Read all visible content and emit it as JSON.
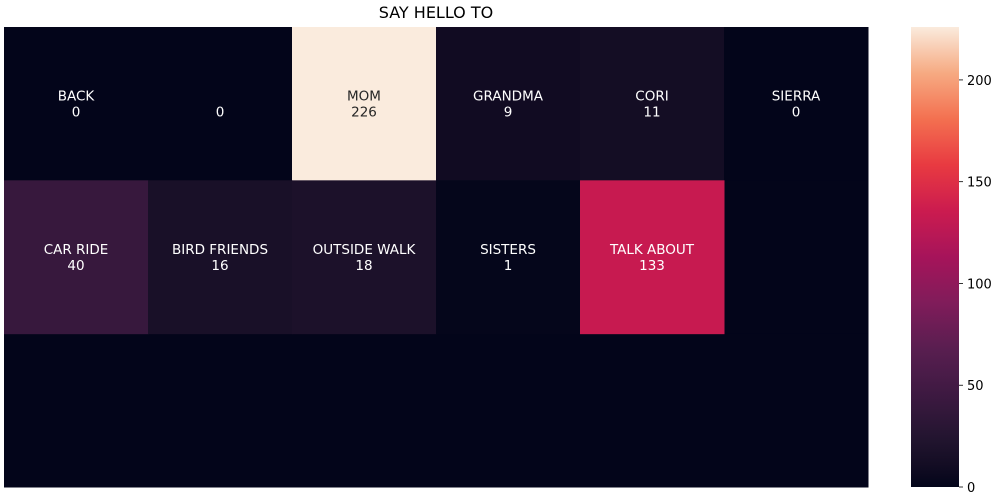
{
  "chart_data": {
    "type": "heatmap",
    "title": "SAY HELLO TO",
    "rows": 3,
    "cols": 6,
    "vmin": 0,
    "vmax": 226,
    "colormap": "rocket",
    "cells": [
      {
        "row": 0,
        "col": 0,
        "label": "BACK",
        "value": 0
      },
      {
        "row": 0,
        "col": 1,
        "label": "",
        "value": 0
      },
      {
        "row": 0,
        "col": 2,
        "label": "MOM",
        "value": 226
      },
      {
        "row": 0,
        "col": 3,
        "label": "GRANDMA",
        "value": 9
      },
      {
        "row": 0,
        "col": 4,
        "label": "CORI",
        "value": 11
      },
      {
        "row": 0,
        "col": 5,
        "label": "SIERRA",
        "value": 0
      },
      {
        "row": 1,
        "col": 0,
        "label": "CAR RIDE",
        "value": 40
      },
      {
        "row": 1,
        "col": 1,
        "label": "BIRD FRIENDS",
        "value": 16
      },
      {
        "row": 1,
        "col": 2,
        "label": "OUTSIDE WALK",
        "value": 18
      },
      {
        "row": 1,
        "col": 3,
        "label": "SISTERS",
        "value": 1
      },
      {
        "row": 1,
        "col": 4,
        "label": "TALK ABOUT",
        "value": 133
      }
    ],
    "colorbar": {
      "ticks": [
        0,
        50,
        100,
        150,
        200
      ]
    }
  }
}
